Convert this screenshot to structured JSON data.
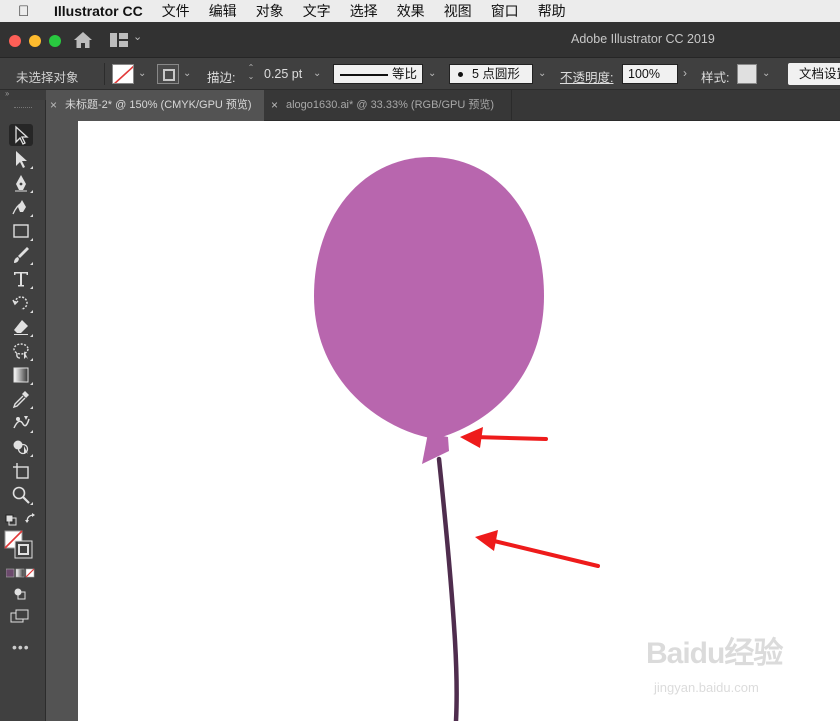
{
  "menubar": {
    "app": "Illustrator CC",
    "items": [
      "文件",
      "编辑",
      "对象",
      "文字",
      "选择",
      "效果",
      "视图",
      "窗口",
      "帮助"
    ]
  },
  "window": {
    "title": "Adobe Illustrator CC 2019"
  },
  "controlbar": {
    "no_selection": "未选择对象",
    "stroke_label": "描边:",
    "stroke_weight": "0.25 pt",
    "profile_label": "等比",
    "brush_label": "5 点圆形",
    "opacity_label": "不透明度:",
    "opacity_value": "100%",
    "style_label": "样式:",
    "doc_settings": "文档设置"
  },
  "tabs": [
    {
      "label": "未标题-2* @ 150% (CMYK/GPU 预览)",
      "active": true
    },
    {
      "label": "alogo1630.ai* @ 33.33% (RGB/GPU 预览)",
      "active": false
    }
  ],
  "tools": [
    "selection-tool",
    "direct-selection-tool",
    "pen-tool",
    "curvature-tool",
    "rectangle-tool",
    "paintbrush-tool",
    "type-tool",
    "rotate-tool",
    "eraser-tool",
    "lasso-tool",
    "gradient-tool",
    "eyedropper-tool",
    "puppet-warp-tool",
    "shape-builder-tool",
    "artboard-tool",
    "zoom-tool"
  ],
  "artwork": {
    "balloon_color": "#b866ae",
    "string_color": "#4f2d4e",
    "arrow_color": "#ee1b1b"
  },
  "watermark": {
    "brand": "Baidu经验",
    "url": "jingyan.baidu.com"
  }
}
